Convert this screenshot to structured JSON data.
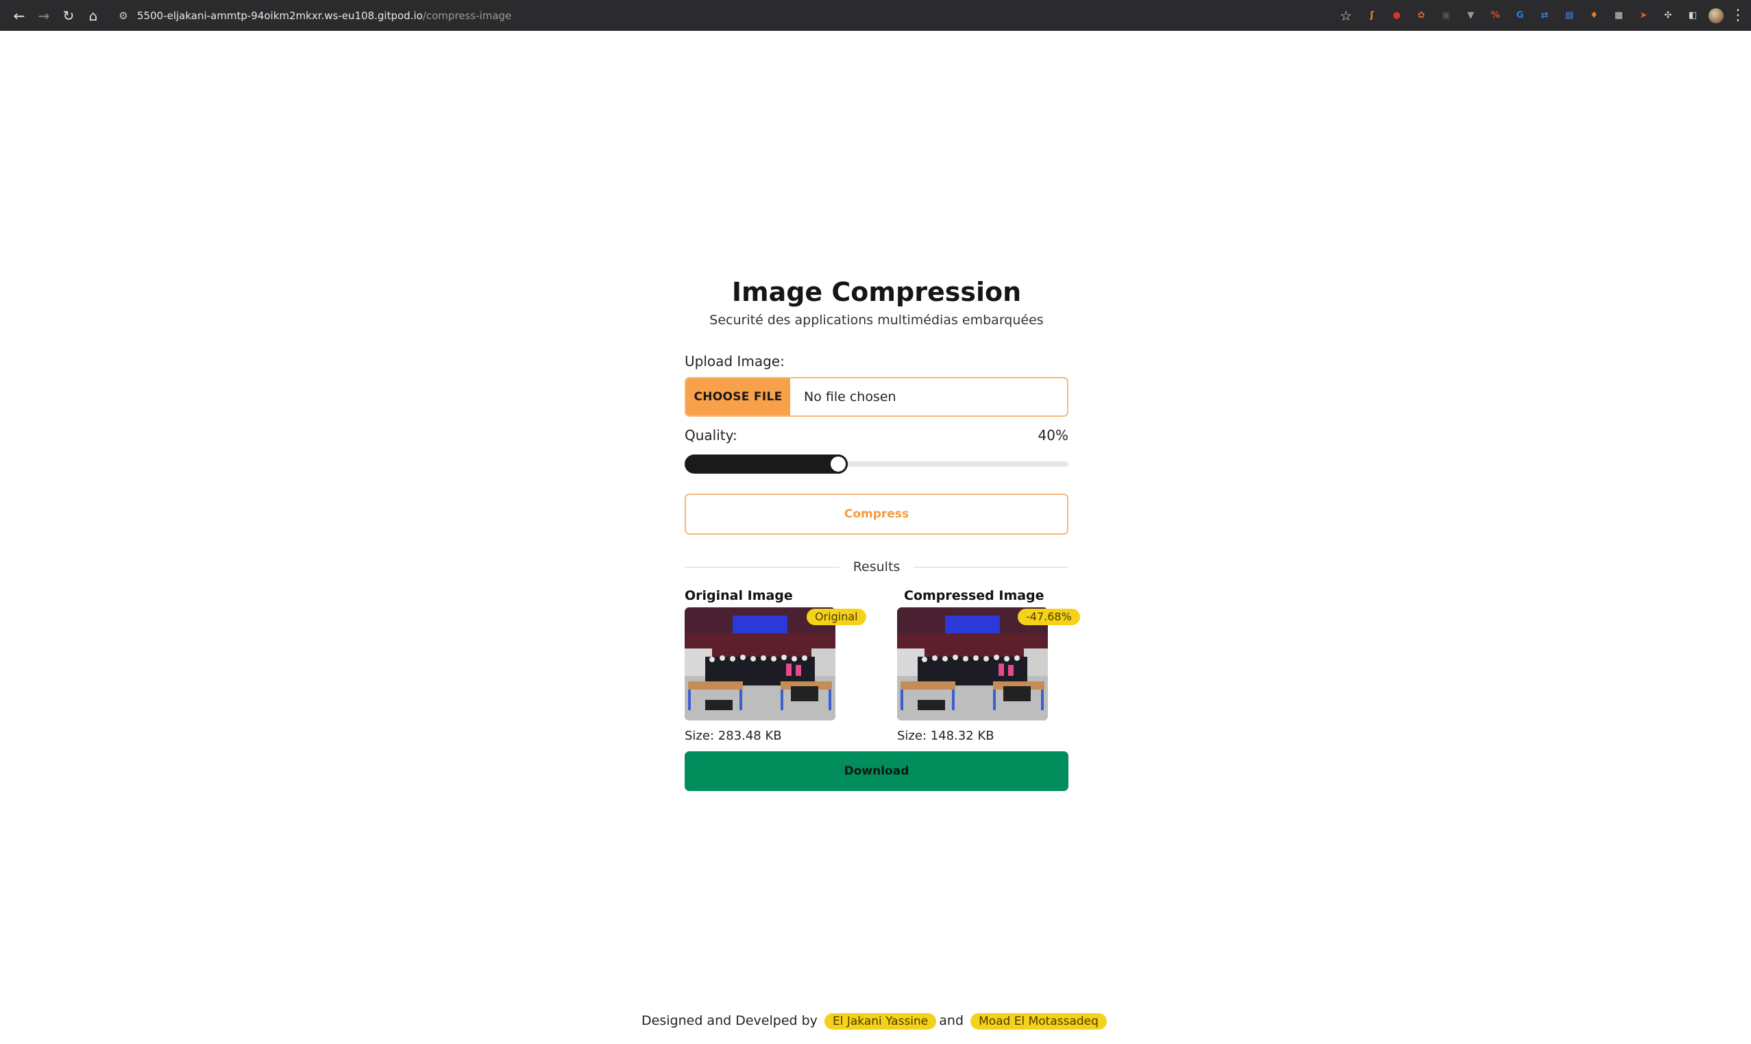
{
  "browser": {
    "url_host": "5500-eljakani-ammtp-94oikm2mkxr.ws-eu108.gitpod.io",
    "url_path": "/compress-image",
    "extensions": [
      {
        "name": "fox-extension-icon",
        "glyph": "ʃ",
        "color": "#f08c1e"
      },
      {
        "name": "shield-extension-icon",
        "glyph": "●",
        "color": "#e0322d"
      },
      {
        "name": "cookie-extension-icon",
        "glyph": "✿",
        "color": "#e0632d"
      },
      {
        "name": "terminal-extension-icon",
        "glyph": "▣",
        "color": "#555555"
      },
      {
        "name": "vue-extension-icon",
        "glyph": "▼",
        "color": "#9a9a9a"
      },
      {
        "name": "percent-extension-icon",
        "glyph": "%",
        "color": "#e24a2b"
      },
      {
        "name": "grammar-extension-icon",
        "glyph": "G",
        "color": "#2b7de9"
      },
      {
        "name": "translate-extension-icon",
        "glyph": "⇄",
        "color": "#3d7fe0"
      },
      {
        "name": "docs-extension-icon",
        "glyph": "▤",
        "color": "#4a8af4"
      },
      {
        "name": "metamask-extension-icon",
        "glyph": "♦",
        "color": "#e8821e"
      },
      {
        "name": "qr-extension-icon",
        "glyph": "▦",
        "color": "#cfcfcf"
      },
      {
        "name": "postman-extension-icon",
        "glyph": "➤",
        "color": "#ef5b25"
      },
      {
        "name": "puzzle-extension-icon",
        "glyph": "✣",
        "color": "#d8d8d8"
      },
      {
        "name": "sidepanel-icon",
        "glyph": "◧",
        "color": "#d8d8d8"
      }
    ]
  },
  "app": {
    "title": "Image Compression",
    "subtitle": "Securité des applications multimédias embarquées",
    "upload_label": "Upload Image:",
    "choose_file_label": "CHOOSE FILE",
    "file_status": "No file chosen",
    "quality_label": "Quality:",
    "quality_value": "40%",
    "quality_fraction": 0.4,
    "compress_label": "Compress",
    "results_label": "Results",
    "original": {
      "title": "Original Image",
      "badge": "Original",
      "size": "Size: 283.48 KB"
    },
    "compressed": {
      "title": "Compressed Image",
      "badge": "-47.68%",
      "size": "Size: 148.32 KB"
    },
    "download_label": "Download"
  },
  "footer": {
    "prefix": "Designed and Develped by",
    "author1": "El Jakani Yassine",
    "conjunction": "and",
    "author2": "Moad El Motassadeq"
  },
  "colors": {
    "accent_orange": "#f9a04a",
    "download_green": "#028d5d",
    "badge_yellow": "#f5d21a"
  }
}
